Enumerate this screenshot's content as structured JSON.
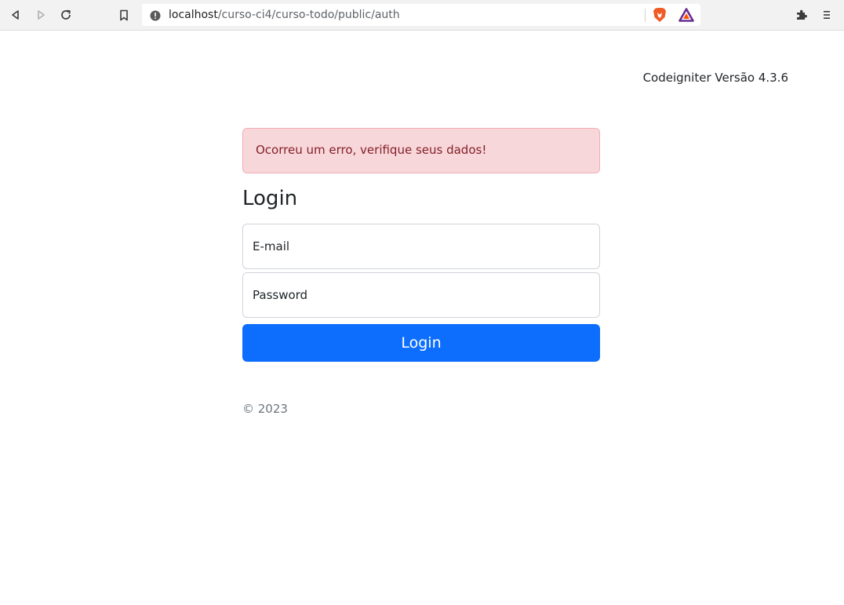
{
  "browser": {
    "url_host": "localhost",
    "url_path": "/curso-ci4/curso-todo/public/auth",
    "icons": [
      "back-icon",
      "forward-icon",
      "reload-icon",
      "bookmark-icon",
      "site-info-icon",
      "brave-shields-icon",
      "brave-rewards-icon",
      "extensions-icon",
      "menu-icon"
    ]
  },
  "page": {
    "version": "Codeigniter Versão 4.3.6",
    "alert": "Ocorreu um erro, verifique seus dados!",
    "title": "Login",
    "email_placeholder": "E-mail",
    "password_placeholder": "Password",
    "login_button": "Login",
    "footer": "© 2023"
  },
  "colors": {
    "primary": "#0d6efd",
    "alert_bg": "#f8d7da",
    "alert_text": "#842029"
  }
}
